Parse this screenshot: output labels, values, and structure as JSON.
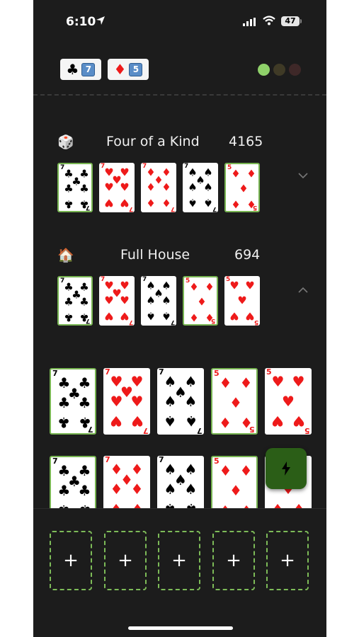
{
  "status_bar": {
    "time": "6:10",
    "battery": "47"
  },
  "filter_chips": [
    {
      "suit": "♣",
      "suit_name": "clubs",
      "count": "7",
      "color": "#000000"
    },
    {
      "suit": "♦",
      "suit_name": "diamonds",
      "count": "5",
      "color": "#ee1a1a"
    }
  ],
  "status_dots": [
    {
      "state": "active",
      "color": "#8fd16a"
    },
    {
      "state": "inactive",
      "color": "#3f3a26"
    },
    {
      "state": "inactive",
      "color": "#3e2828"
    }
  ],
  "hands": [
    {
      "emoji": "🎲",
      "name": "Four of a Kind",
      "score": "4165",
      "expanded": false,
      "cards": [
        {
          "rank": "7",
          "suit": "♣",
          "color": "black",
          "selected": true
        },
        {
          "rank": "7",
          "suit": "♥",
          "color": "red",
          "selected": false
        },
        {
          "rank": "7",
          "suit": "♦",
          "color": "red",
          "selected": false
        },
        {
          "rank": "7",
          "suit": "♠",
          "color": "black",
          "selected": false
        },
        {
          "rank": "5",
          "suit": "♦",
          "color": "red",
          "selected": true
        }
      ]
    },
    {
      "emoji": "🏠",
      "name": "Full House",
      "score": "694",
      "expanded": true,
      "cards": [
        {
          "rank": "7",
          "suit": "♣",
          "color": "black",
          "selected": true
        },
        {
          "rank": "7",
          "suit": "♥",
          "color": "red",
          "selected": false
        },
        {
          "rank": "7",
          "suit": "♠",
          "color": "black",
          "selected": false
        },
        {
          "rank": "5",
          "suit": "♦",
          "color": "red",
          "selected": true
        },
        {
          "rank": "5",
          "suit": "♥",
          "color": "red",
          "selected": false
        }
      ]
    }
  ],
  "card_rows": [
    [
      {
        "rank": "7",
        "suit": "♣",
        "color": "black",
        "selected": true
      },
      {
        "rank": "7",
        "suit": "♥",
        "color": "red",
        "selected": false
      },
      {
        "rank": "7",
        "suit": "♠",
        "color": "black",
        "selected": false
      },
      {
        "rank": "5",
        "suit": "♦",
        "color": "red",
        "selected": true
      },
      {
        "rank": "5",
        "suit": "♥",
        "color": "red",
        "selected": false
      }
    ],
    [
      {
        "rank": "7",
        "suit": "♣",
        "color": "black",
        "selected": true
      },
      {
        "rank": "7",
        "suit": "♦",
        "color": "red",
        "selected": false
      },
      {
        "rank": "7",
        "suit": "♠",
        "color": "black",
        "selected": false
      },
      {
        "rank": "5",
        "suit": "♦",
        "color": "red",
        "selected": true
      },
      {
        "rank": "5",
        "suit": "♦",
        "color": "red",
        "selected": false
      }
    ]
  ],
  "empty_slots": [
    "+",
    "+",
    "+",
    "+",
    "+"
  ],
  "fab": {
    "icon": "lightning-icon"
  },
  "accent_color": "#78b552"
}
